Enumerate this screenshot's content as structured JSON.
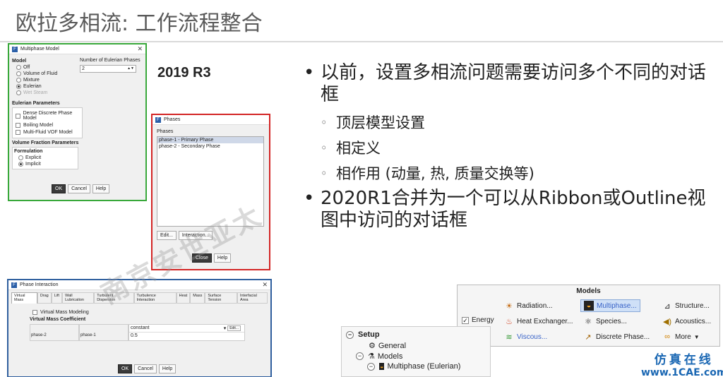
{
  "slide": {
    "title": "欧拉多相流: 工作流程整合",
    "version_label": "2019 R3"
  },
  "multiphase_dialog": {
    "title": "Multiphase Model",
    "model_label": "Model",
    "models": [
      "Off",
      "Volume of Fluid",
      "Mixture",
      "Eulerian",
      "Wet Steam"
    ],
    "selected_model": "Eulerian",
    "num_phases_label": "Number of Eulerian Phases",
    "num_phases_value": "2",
    "eulerian_params_label": "Eulerian Parameters",
    "eulerian_options": [
      "Dense Discrete Phase Model",
      "Boiling Model",
      "Multi-Fluid VOF Model"
    ],
    "vf_params_label": "Volume Fraction Parameters",
    "formulation_label": "Formulation",
    "formulations": [
      "Explicit",
      "Implicit"
    ],
    "selected_formulation": "Implicit",
    "ok": "OK",
    "cancel": "Cancel",
    "help": "Help"
  },
  "phases_dialog": {
    "title": "Phases",
    "list_label": "Phases",
    "phases": [
      "phase-1 - Primary Phase",
      "phase-2 - Secondary Phase"
    ],
    "edit": "Edit...",
    "interaction": "Interaction...",
    "close": "Close",
    "help": "Help"
  },
  "interaction_dialog": {
    "title": "Phase Interaction",
    "tabs": [
      "Virtual Mass",
      "Drag",
      "Lift",
      "Wall Lubrication",
      "Turbulent Dispersion",
      "Turbulence Interaction",
      "Heat",
      "Mass",
      "Surface Tension",
      "Interfacial Area"
    ],
    "virtual_mass_modeling": "Virtual Mass Modeling",
    "coefficient_label": "Virtual Mass Coefficient",
    "row_phase_a": "phase-2",
    "row_phase_b": "phase-1",
    "method": "constant",
    "edit": "Edit...",
    "value": "0.5",
    "ok": "OK",
    "cancel": "Cancel",
    "help": "Help"
  },
  "bullets": {
    "b1": "以前，设置多相流问题需要访问多个不同的对话框",
    "sub": [
      "顶层模型设置",
      "相定义",
      "相作用 (动量, 热, 质量交换等)"
    ],
    "b2": "2020R1合并为一个可以从Ribbon或Outline视图中访问的对话框"
  },
  "ribbon": {
    "header": "Models",
    "energy": "Energy",
    "radiation": "Radiation...",
    "multiphase": "Multiphase...",
    "structure": "Structure...",
    "heat_exchanger": "Heat Exchanger...",
    "species": "Species...",
    "acoustics": "Acoustics...",
    "viscous": "Viscous...",
    "discrete_phase": "Discrete Phase...",
    "more": "More"
  },
  "outline": {
    "setup": "Setup",
    "general": "General",
    "models": "Models",
    "multiphase": "Multiphase (Eulerian)"
  },
  "watermark": {
    "center": "南京安世亚太",
    "right_line1": "仿真在线",
    "right_line2": "www.1CAE.com"
  },
  "colors": {
    "green_frame": "#38a83a",
    "red_frame": "#d32525",
    "blue_frame": "#2f5f9e",
    "highlight": "#3a64c8"
  }
}
